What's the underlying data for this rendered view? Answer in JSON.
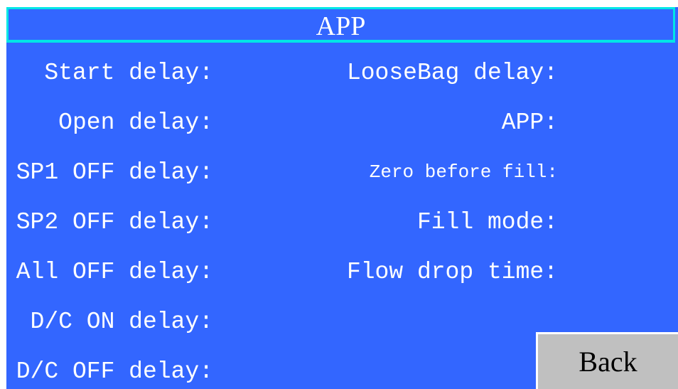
{
  "window": {
    "title": "APP"
  },
  "left_column": {
    "items": [
      {
        "label": "Start delay:"
      },
      {
        "label": "Open delay:"
      },
      {
        "label": "SP1 OFF delay:"
      },
      {
        "label": "SP2 OFF delay:"
      },
      {
        "label": "All OFF delay:"
      },
      {
        "label": "D/C ON delay:"
      },
      {
        "label": "D/C OFF delay:"
      }
    ]
  },
  "right_column": {
    "items": [
      {
        "label": "LooseBag delay:"
      },
      {
        "label": "APP:"
      },
      {
        "label": "Zero before fill:"
      },
      {
        "label": "Fill mode:"
      },
      {
        "label": "Flow drop time:"
      }
    ]
  },
  "footer": {
    "back_label": "Back"
  },
  "colors": {
    "background": "#3366ff",
    "title_border": "#00e6e6",
    "text": "#ffffff",
    "button": "#c0c0c0"
  }
}
